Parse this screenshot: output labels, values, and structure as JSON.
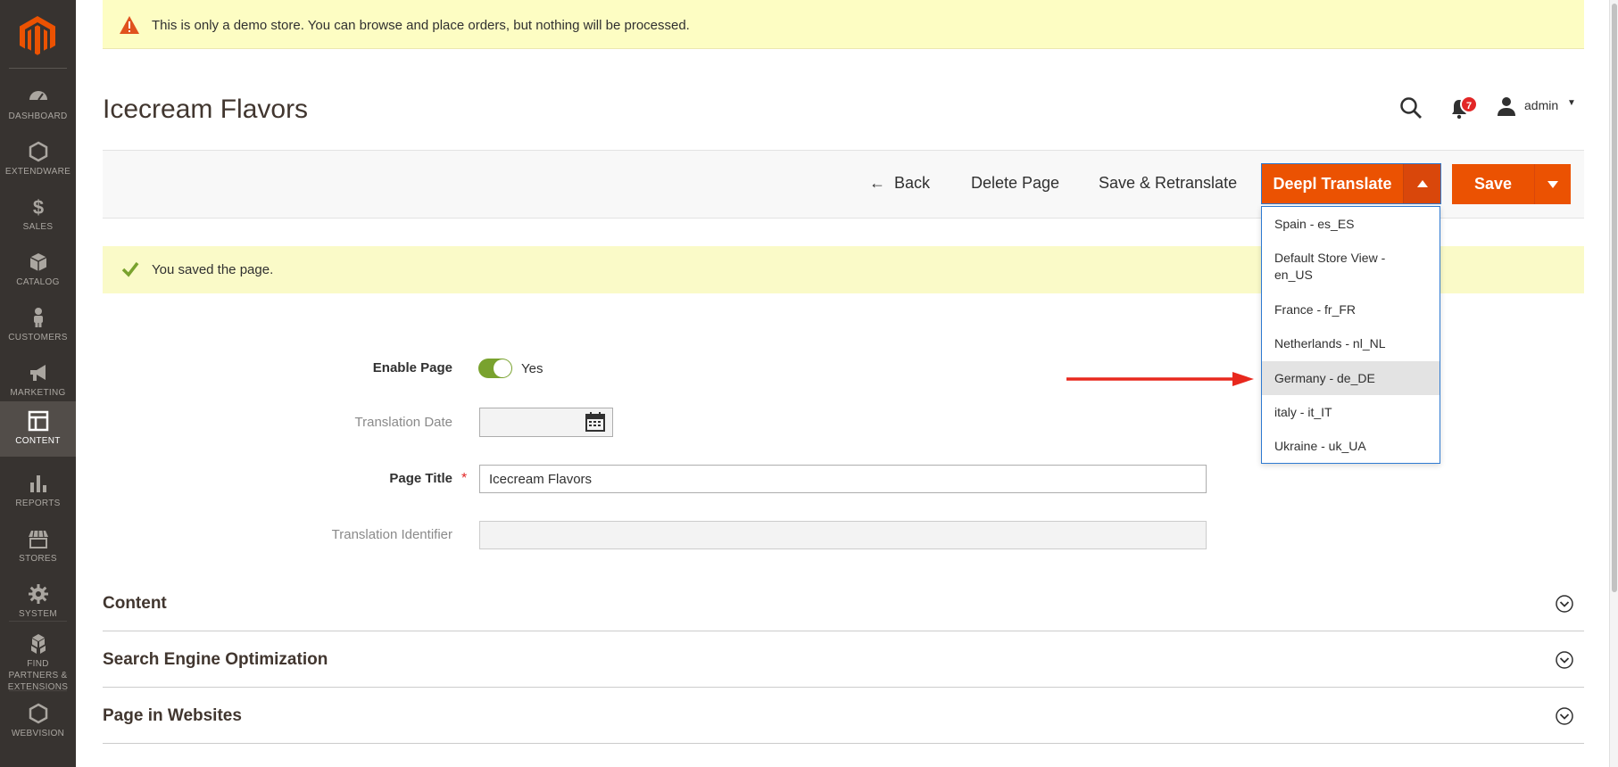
{
  "app": {
    "accent_color": "#eb5202",
    "sidebar_bg": "#373330"
  },
  "sidebar": {
    "items": [
      {
        "label": "DASHBOARD",
        "icon": "dashboard-icon"
      },
      {
        "label": "EXTENDWARE",
        "icon": "hexagon-icon"
      },
      {
        "label": "SALES",
        "icon": "dollar-icon"
      },
      {
        "label": "CATALOG",
        "icon": "box-icon"
      },
      {
        "label": "CUSTOMERS",
        "icon": "person-icon"
      },
      {
        "label": "MARKETING",
        "icon": "megaphone-icon"
      },
      {
        "label": "CONTENT",
        "icon": "layout-icon",
        "active": true
      },
      {
        "label": "REPORTS",
        "icon": "bar-chart-icon"
      },
      {
        "label": "STORES",
        "icon": "store-icon"
      },
      {
        "label": "SYSTEM",
        "icon": "gear-icon"
      },
      {
        "label": "FIND PARTNERS & EXTENSIONS",
        "icon": "cubes-icon"
      },
      {
        "label": "WEBVISION",
        "icon": "hexagon-icon"
      }
    ]
  },
  "notice": {
    "text": "This is only a demo store. You can browse and place orders, but nothing will be processed."
  },
  "header": {
    "page_title": "Icecream Flavors",
    "notification_count": "7",
    "user": "admin"
  },
  "actions": {
    "back": "Back",
    "delete": "Delete Page",
    "retranslate": "Save & Retranslate",
    "deepl": "Deepl Translate",
    "save": "Save"
  },
  "deepl_menu": {
    "items": [
      "Spain - es_ES",
      "Default Store View - en_US",
      "France - fr_FR",
      "Netherlands - nl_NL",
      "Germany - de_DE",
      "italy - it_IT",
      "Ukraine - uk_UA"
    ],
    "highlighted": "Germany - de_DE"
  },
  "messages": {
    "success": "You saved the page."
  },
  "form": {
    "enable_label": "Enable Page",
    "enable_value": "Yes",
    "enable_on": true,
    "date_label": "Translation Date",
    "date_value": "",
    "title_label": "Page Title",
    "title_value": "Icecream Flavors",
    "identifier_label": "Translation Identifier",
    "identifier_value": ""
  },
  "sections": [
    {
      "title": "Content"
    },
    {
      "title": "Search Engine Optimization"
    },
    {
      "title": "Page in Websites"
    }
  ]
}
